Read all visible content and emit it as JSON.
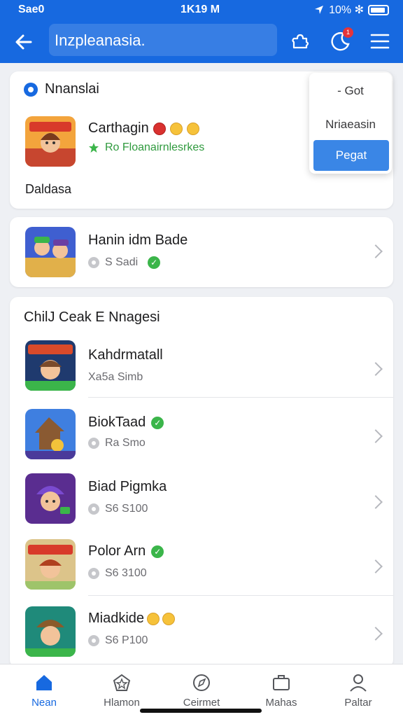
{
  "status_bar": {
    "carrier": "Sae0",
    "time": "1K19 M",
    "battery_text": "10% ✻"
  },
  "header": {
    "search_value": "Inzpleanasia.",
    "notification_count": "1"
  },
  "featured": {
    "section_title": "Nnanslai",
    "game": {
      "title": "Carthagin",
      "subtitle": "Ro Floanairnlesrkes",
      "footer": "Daldasa"
    },
    "popup": {
      "option_1": "- Got",
      "option_2": "Nriaeasin",
      "primary": "Pegat"
    }
  },
  "single_game": {
    "title": "Hanin idm Bade",
    "meta": "S Sadi"
  },
  "list_section": {
    "title": "ChilJ Ceak E Nnagesi",
    "items": [
      {
        "title": "Kahdrmatall",
        "meta": "Xa5a Simb"
      },
      {
        "title": "BiokTaad",
        "meta": "Ra Smo"
      },
      {
        "title": "Biad Pigmka",
        "meta": "S6 S100"
      },
      {
        "title": "Polor Arn",
        "meta": "S6 3100"
      },
      {
        "title": "Miadkide",
        "meta": "S6 P100"
      }
    ]
  },
  "bottom_nav": {
    "item_1": "Nean",
    "item_2": "Hlamon",
    "item_3": "Ceirmet",
    "item_4": "Mahas",
    "item_5": "Paltar"
  },
  "colors": {
    "brand": "#1769e0",
    "accent_button": "#3a86e6",
    "green_badge": "#3bb54a"
  }
}
